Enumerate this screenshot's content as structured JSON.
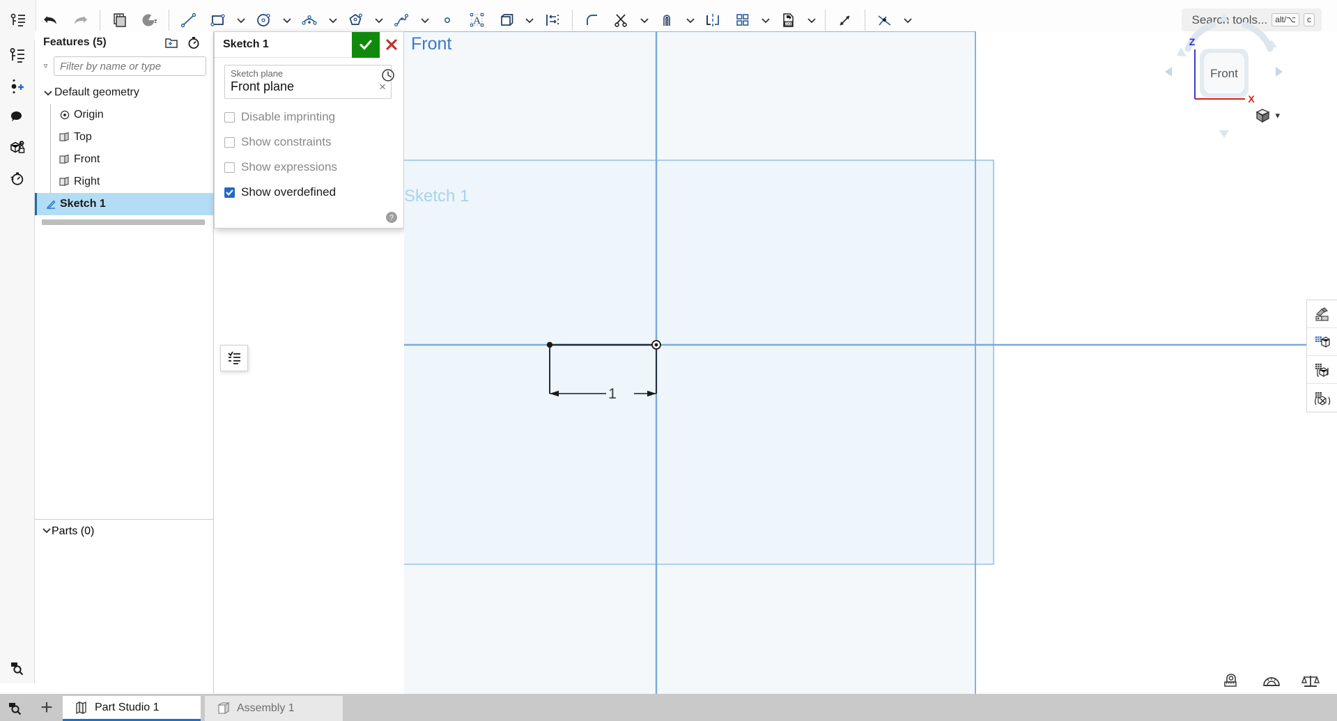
{
  "app": {
    "brand_blue": "#2b6cb8",
    "accept_green": "#108a0a",
    "cancel_red": "#c0392b",
    "selection_blue": "#b3dcf5"
  },
  "toolbar": {
    "feature_list_toggle": "feature-list-toggle",
    "items": [
      {
        "name": "undo-icon",
        "caret": false
      },
      {
        "name": "redo-icon",
        "caret": false
      },
      {
        "name": "sep-1",
        "caret": false
      },
      {
        "name": "copy-layers-icon",
        "caret": false
      },
      {
        "name": "pie-section-icon",
        "caret": false
      },
      {
        "name": "sep-2",
        "caret": false
      },
      {
        "name": "line-icon",
        "caret": false
      },
      {
        "name": "rectangle-icon",
        "caret": true
      },
      {
        "name": "circle-icon",
        "caret": true
      },
      {
        "name": "arc-icon",
        "caret": true
      },
      {
        "name": "polygon-icon",
        "caret": true
      },
      {
        "name": "spline-icon",
        "caret": true
      },
      {
        "name": "point-icon",
        "caret": false
      },
      {
        "name": "text-icon",
        "caret": false
      },
      {
        "name": "use-projection-icon",
        "caret": true
      },
      {
        "name": "dimension-icon",
        "caret": false
      },
      {
        "name": "sep-3",
        "caret": false
      },
      {
        "name": "fillet-icon",
        "caret": false
      },
      {
        "name": "trim-icon",
        "caret": true
      },
      {
        "name": "offset-icon",
        "caret": true
      },
      {
        "name": "mirror-icon",
        "caret": false
      },
      {
        "name": "linear-pattern-icon",
        "caret": true
      },
      {
        "name": "import-dxf-icon",
        "caret": true
      },
      {
        "name": "sep-4",
        "caret": false
      },
      {
        "name": "transform-icon",
        "caret": false
      },
      {
        "name": "sep-5",
        "caret": false
      },
      {
        "name": "constraint-icon",
        "caret": true
      }
    ]
  },
  "search": {
    "placeholder": "Search tools...",
    "shortcut_modifier": "alt/⌥",
    "shortcut_key": "c"
  },
  "left_rail": {
    "items": [
      {
        "label": "Feature list",
        "icon": "feature-list-icon"
      },
      {
        "label": "Add version",
        "icon": "add-version-icon"
      },
      {
        "label": "Comments",
        "icon": "comment-icon"
      },
      {
        "label": "Part permissions",
        "icon": "part-lock-icon"
      },
      {
        "label": "History",
        "icon": "history-stopwatch-icon"
      }
    ],
    "bottom_item": {
      "label": "Search in document",
      "icon": "magnify-box-icon"
    }
  },
  "feature_panel": {
    "title": "Features (5)",
    "header_buttons": [
      {
        "name": "new-folder-button",
        "icon": "new-folder-icon"
      },
      {
        "name": "rollback-button",
        "icon": "stopwatch-icon"
      }
    ],
    "filter_placeholder": "Filter by name or type",
    "filter_value": "",
    "tree": [
      {
        "label": "Default geometry",
        "icon": "chevron-down-icon",
        "level": 0,
        "type": "folder",
        "expanded": true
      },
      {
        "label": "Origin",
        "icon": "origin-icon",
        "level": 1,
        "type": "origin"
      },
      {
        "label": "Top",
        "icon": "plane-icon",
        "level": 1,
        "type": "plane"
      },
      {
        "label": "Front",
        "icon": "plane-icon",
        "level": 1,
        "type": "plane"
      },
      {
        "label": "Right",
        "icon": "plane-icon",
        "level": 1,
        "type": "plane"
      },
      {
        "label": "Sketch 1",
        "icon": "sketch-pencil-icon",
        "level": 0,
        "type": "sketch",
        "selected": true
      }
    ],
    "parts_section": {
      "label": "Parts (0)",
      "expanded": true
    }
  },
  "sketch_dialog": {
    "title": "Sketch 1",
    "accept_label": "✓",
    "cancel_label": "✕",
    "plane_field_label": "Sketch plane",
    "plane_field_value": "Front plane",
    "plane_clear_label": "×",
    "checkboxes": [
      {
        "label": "Disable imprinting",
        "checked": false
      },
      {
        "label": "Show constraints",
        "checked": false
      },
      {
        "label": "Show expressions",
        "checked": false
      },
      {
        "label": "Show overdefined",
        "checked": true
      }
    ],
    "help_icon": "help-circle-icon",
    "history_icon": "sketch-history-icon",
    "list_button_icon": "constraint-list-icon"
  },
  "canvas": {
    "plane_label": "Front",
    "sketch_label": "Sketch 1",
    "dimension_value": "1",
    "grid_color": "#f4f8fb",
    "plane_outline_color": "#8fbde4",
    "axis_color": "#7aa9d9",
    "sketch_line_color": "#1f2f3d"
  },
  "view_cube": {
    "face_label": "Front",
    "axis_z_label": "Z",
    "axis_x_label": "X",
    "axis_z_color": "#3030cc",
    "axis_x_color": "#d02020",
    "view_style_icon": "view-cube-icon",
    "dropdown_caret": "▾"
  },
  "right_rail": {
    "items": [
      {
        "name": "appearance-button",
        "icon": "appearance-icon"
      },
      {
        "name": "display-grid-button",
        "icon": "display-grid-icon"
      },
      {
        "name": "section-view-button",
        "icon": "section-view-icon"
      },
      {
        "name": "explode-view-button",
        "icon": "explode-view-icon"
      }
    ]
  },
  "measure_tools": [
    {
      "name": "measure-tape-button",
      "icon": "tape-measure-icon"
    },
    {
      "name": "protractor-button",
      "icon": "protractor-icon"
    },
    {
      "name": "mass-properties-button",
      "icon": "scale-balance-icon"
    }
  ],
  "tab_bar": {
    "search_icon": "tab-search-icon",
    "add_label": "+",
    "tabs": [
      {
        "label": "Part Studio 1",
        "icon": "part-studio-icon",
        "active": true
      },
      {
        "label": "Assembly 1",
        "icon": "assembly-icon",
        "active": false
      }
    ]
  }
}
